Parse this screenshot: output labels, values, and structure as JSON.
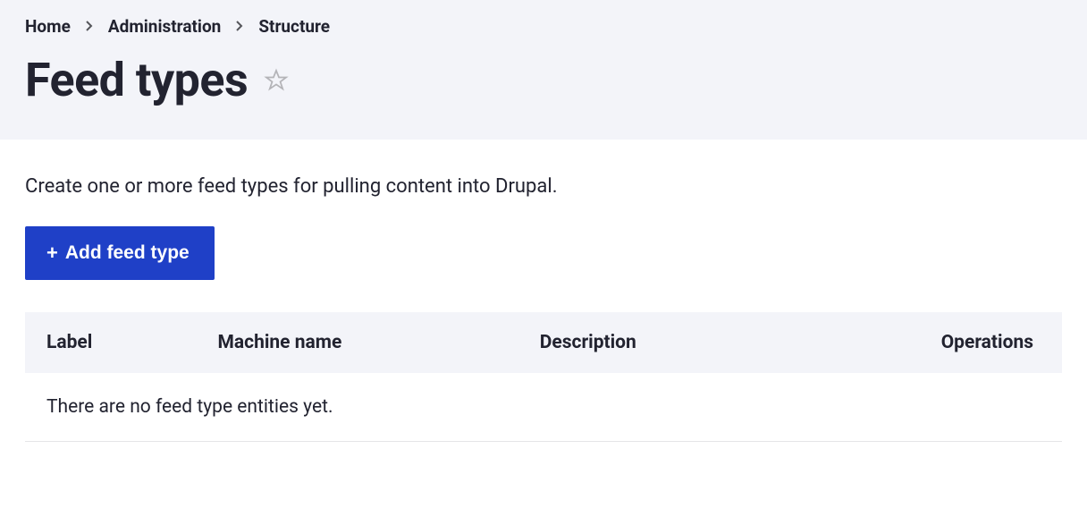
{
  "breadcrumb": {
    "items": [
      {
        "label": "Home"
      },
      {
        "label": "Administration"
      },
      {
        "label": "Structure"
      }
    ]
  },
  "page": {
    "title": "Feed types",
    "intro": "Create one or more feed types for pulling content into Drupal.",
    "add_button": "Add feed type",
    "empty_message": "There are no feed type entities yet."
  },
  "table": {
    "columns": {
      "label": "Label",
      "machine_name": "Machine name",
      "description": "Description",
      "operations": "Operations"
    }
  }
}
